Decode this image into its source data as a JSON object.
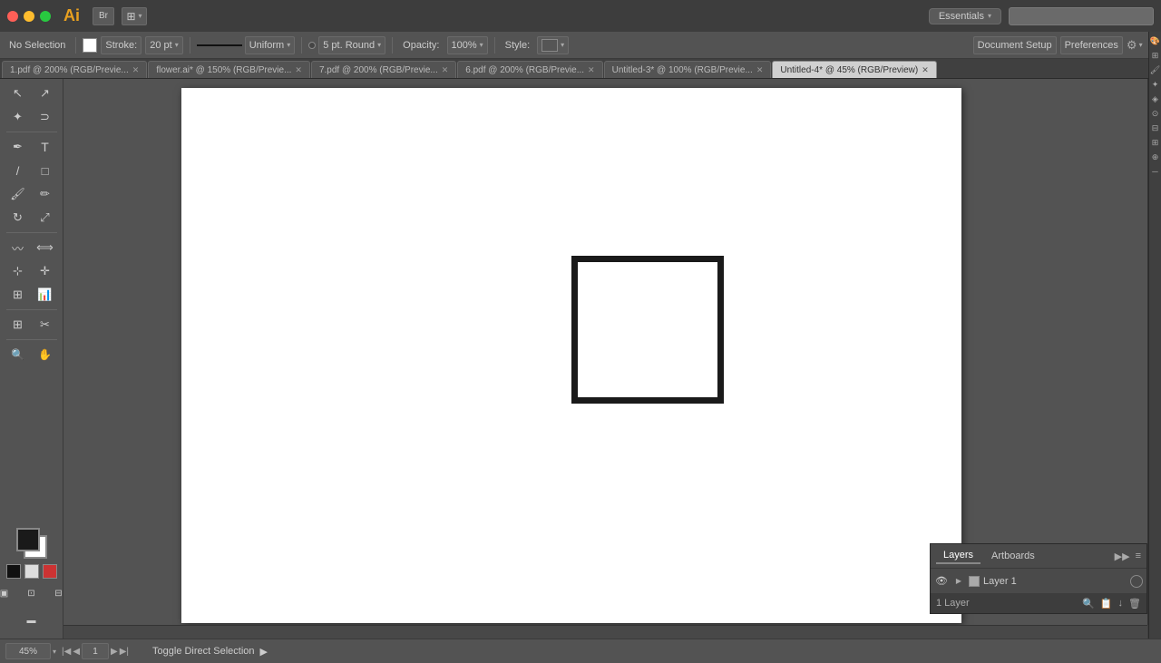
{
  "app": {
    "name": "Ai",
    "icon_color": "#e8a020"
  },
  "window": {
    "close_label": "",
    "minimize_label": "",
    "maximize_label": ""
  },
  "title_bar": {
    "workspace_label": "Essentials",
    "search_placeholder": ""
  },
  "toolbar": {
    "no_selection_label": "No Selection",
    "stroke_label": "Stroke:",
    "stroke_value": "20 pt",
    "stroke_type": "Uniform",
    "dot_label": "5 pt. Round",
    "opacity_label": "Opacity:",
    "opacity_value": "100%",
    "style_label": "Style:",
    "document_setup_label": "Document Setup",
    "preferences_label": "Preferences"
  },
  "tabs": [
    {
      "id": "tab1",
      "label": "1.pdf @ 200% (RGB/Previe...",
      "active": false
    },
    {
      "id": "tab2",
      "label": "flower.ai* @ 150% (RGB/Previe...",
      "active": false
    },
    {
      "id": "tab3",
      "label": "7.pdf @ 200% (RGB/Previe...",
      "active": false
    },
    {
      "id": "tab4",
      "label": "6.pdf @ 200% (RGB/Previe...",
      "active": false
    },
    {
      "id": "tab5",
      "label": "Untitled-3* @ 100% (RGB/Previe...",
      "active": false
    },
    {
      "id": "tab6",
      "label": "Untitled-4* @ 45% (RGB/Preview)",
      "active": true
    }
  ],
  "layers": {
    "panel_title": "Layers",
    "artboards_tab": "Artboards",
    "layer_name": "Layer 1",
    "layers_count": "1 Layer",
    "items": [
      {
        "name": "Layer 1",
        "visible": true,
        "locked": false
      }
    ]
  },
  "status_bar": {
    "zoom_value": "45%",
    "page_nav_prev": "◀",
    "page_nav_next": "▶",
    "page_first": "|◀",
    "page_last": "▶|",
    "page_num": "1",
    "toggle_label": "Toggle Direct Selection",
    "arrow_label": "▶"
  },
  "canvas": {
    "artboard_width": 860,
    "artboard_height": 590
  }
}
